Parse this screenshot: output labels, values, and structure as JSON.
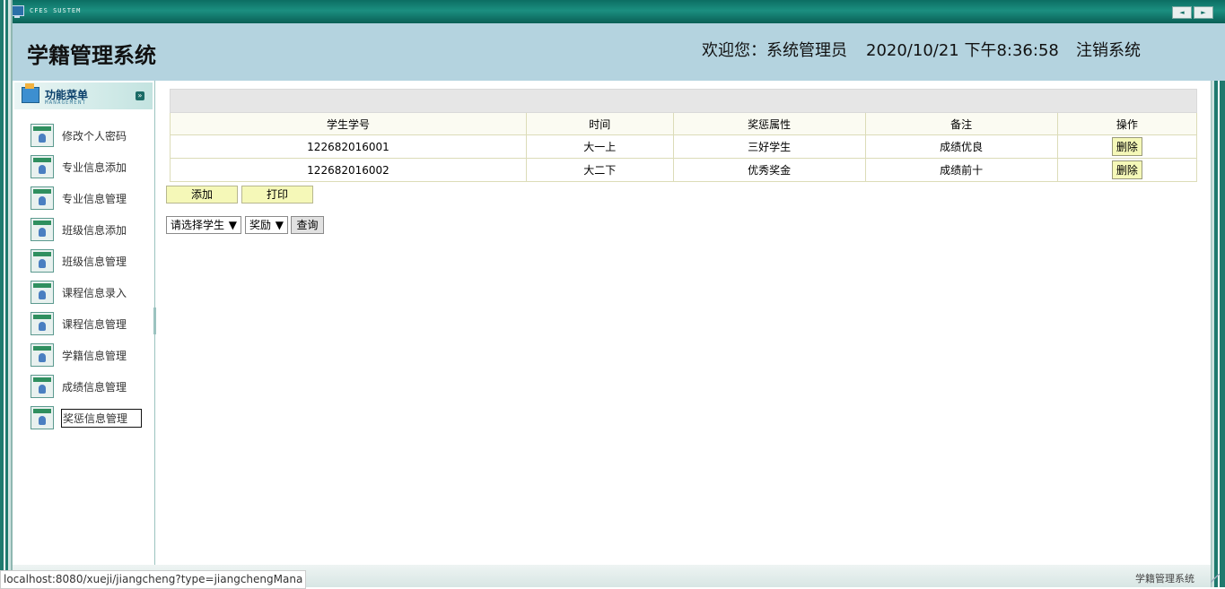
{
  "window": {
    "system_title": "CFES SUSTEM",
    "nav_prev": "◄",
    "nav_next": "►"
  },
  "header": {
    "app_title": "学籍管理系统",
    "welcome": "欢迎您：系统管理员",
    "datetime": "2020/10/21 下午8:36:58",
    "logout": "注销系统"
  },
  "sidebar": {
    "title": "功能菜单",
    "subtitle": "MANAGEMENT",
    "items": [
      {
        "label": "修改个人密码"
      },
      {
        "label": "专业信息添加"
      },
      {
        "label": "专业信息管理"
      },
      {
        "label": "班级信息添加"
      },
      {
        "label": "班级信息管理"
      },
      {
        "label": "课程信息录入"
      },
      {
        "label": "课程信息管理"
      },
      {
        "label": "学籍信息管理"
      },
      {
        "label": "成绩信息管理"
      },
      {
        "label": "奖惩信息管理"
      }
    ]
  },
  "table": {
    "columns": [
      "学生学号",
      "时间",
      "奖惩属性",
      "备注",
      "操作"
    ],
    "rows": [
      {
        "student_id": "122682016001",
        "time": "大一上",
        "type": "三好学生",
        "note": "成绩优良",
        "action": "删除"
      },
      {
        "student_id": "122682016002",
        "time": "大二下",
        "type": "优秀奖金",
        "note": "成绩前十",
        "action": "删除"
      }
    ]
  },
  "actions": {
    "add": "添加",
    "print": "打印"
  },
  "filters": {
    "student_select": "请选择学生",
    "type_select": "奖励",
    "query": "查询"
  },
  "status_bar": {
    "url": "localhost:8080/xueji/jiangcheng?type=jiangchengMana",
    "footer_title": "学籍管理系统"
  }
}
